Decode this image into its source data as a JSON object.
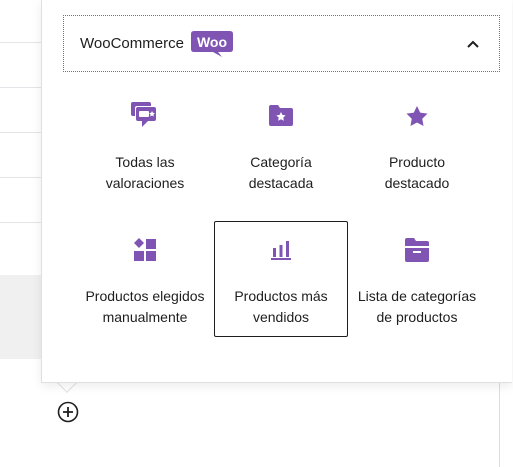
{
  "panel": {
    "title": "WooCommerce",
    "logo_text": "Woo",
    "brand_color": "#7f54b3"
  },
  "blocks": [
    {
      "label": "Todas las valoraciones",
      "icon": "reviews-icon"
    },
    {
      "label": "Categoría destacada",
      "icon": "folder-star-icon"
    },
    {
      "label": "Producto destacado",
      "icon": "star-icon"
    },
    {
      "label": "Productos elegidos manualmente",
      "icon": "hand-picked-products-icon"
    },
    {
      "label": "Productos más vendidos",
      "icon": "bar-chart-icon",
      "selected": true
    },
    {
      "label": "Lista de categorías de productos",
      "icon": "folder-open-icon"
    }
  ],
  "editor": {
    "add_block_icon": "plus-circle-icon"
  }
}
